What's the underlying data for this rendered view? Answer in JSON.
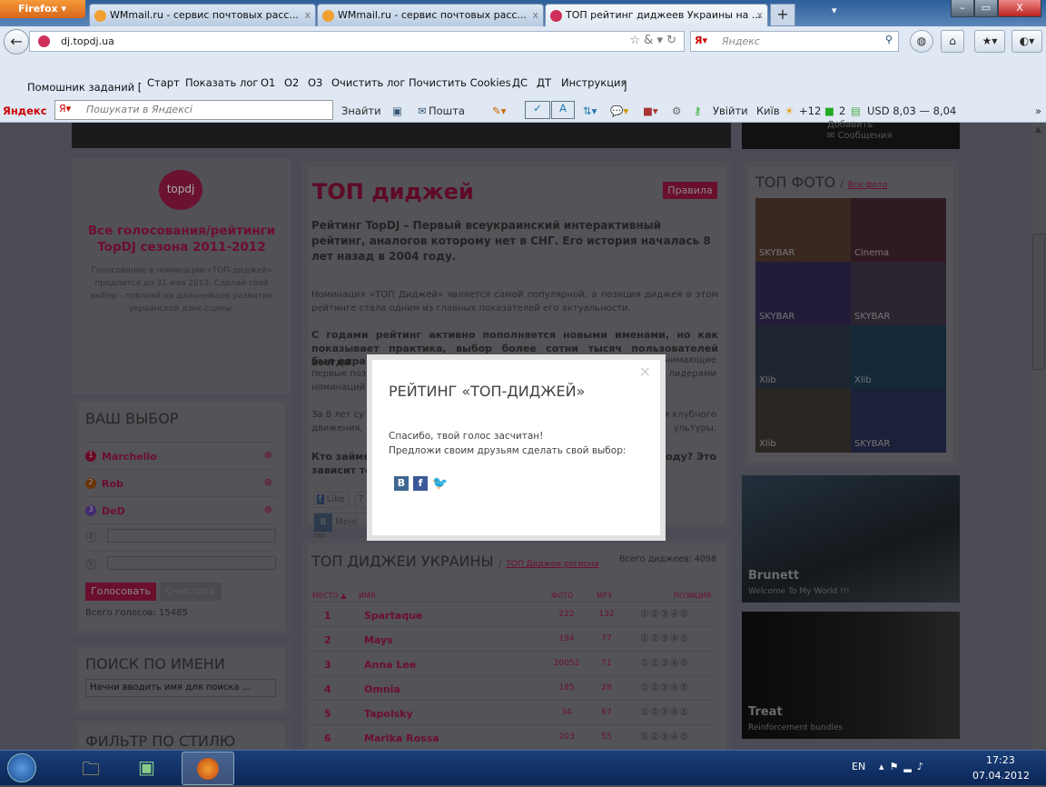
{
  "browser": {
    "menu_button": "Firefox",
    "tabs": [
      {
        "title": "WMmail.ru - сервис почтовых расс..."
      },
      {
        "title": "WMmail.ru - сервис почтовых расс..."
      },
      {
        "title": "ТОП рейтинг диджеев Украины на ..."
      }
    ],
    "url": "dj.topdj.ua",
    "search_placeholder": "Яндекс",
    "bookmarks": {
      "label": "Помошник заданий [",
      "items": [
        "Старт",
        "Показать лог",
        "О1",
        "О2",
        "О3",
        "Очистить лог",
        "Почистить Cookies",
        "ДС",
        "ДТ",
        "Инструкция"
      ],
      "close_bracket": "]"
    },
    "yandex_bar": {
      "logo": "Яндекс",
      "search_placeholder": "Пошукати в Яндексі",
      "find": "Знайти",
      "mail": "Пошта",
      "login": "Увійти",
      "city": "Київ",
      "temp": "+12",
      "count": "2",
      "usd": "USD 8,03 — 8,04"
    }
  },
  "header_right": {
    "add": "Добавить",
    "messages": "Сообщения"
  },
  "promo": {
    "logo": "topdj",
    "title": "Все голосования/рейтинги TopDJ сезона 2011-2012",
    "text": "Голосование в номинации «ТОП-диджей» продлится до 31 мая 2012. Сделай свой выбор - повлияй на дальнейшее развитие украинской дэнс-сцены."
  },
  "choice": {
    "title": "ВАШ ВЫБОР",
    "items": [
      {
        "n": "1",
        "name": "Marchello",
        "color": "#7a0a2a"
      },
      {
        "n": "2",
        "name": "Rob",
        "color": "#7a3a0a"
      },
      {
        "n": "3",
        "name": "DeD",
        "color": "#4a2a7a"
      }
    ],
    "empty": [
      "4",
      "5"
    ],
    "vote": "Голосовать",
    "clear": "Очистить",
    "total": "Всего голосов: 15485"
  },
  "search": {
    "title": "ПОИСК ПО ИМЕНИ",
    "placeholder": "Начни вводить имя для поиска ..."
  },
  "filter": {
    "title": "ФИЛЬТР ПО СТИЛЮ"
  },
  "intro": {
    "title": "ТОП диджей",
    "rules": "Правила",
    "lead": "Рейтинг TopDJ – Первый всеукраинский интерактивный рейтинг, аналогов которому нет в СНГ. Его история началась 8 лет назад в 2004 году.",
    "p1": "Номинация «ТОП Диджей» является самой популярной, а позиция диджея в этом рейтинге стала одним из главных показателей его актуальности.",
    "p2a": "С годами рейтинг активно пополняется новыми именами, но как показывает практика, выбор более сотни тысяч пользователей всегда",
    "p2b": "был опра",
    "p2c": "анимающие",
    "p2d": "первые поз",
    "p2e": "ь лидерами",
    "p2f": "номинаций",
    "p3a": "За 8 лет су",
    "p3b": "и клубного",
    "p3c": "движения,",
    "p3d": "ультуры.",
    "p4a": "Кто займе",
    "p4b": "году? Это",
    "p4c": "зависит то",
    "like": "Like",
    "like_count": "7",
    "vk_like": "Мені по"
  },
  "table": {
    "title": "ТОП ДИДЖЕИ УКРАИНЫ",
    "region_link": "ТОП Диджеи региона",
    "total": "Всего диджеев: 4098",
    "headers": {
      "place": "МЕСТО",
      "name": "ИМЯ",
      "photo": "ФОТО",
      "mp3": "MP3",
      "position": "ПОЗИЦИЯ"
    },
    "positions": "①②③④⑤",
    "rows": [
      {
        "place": "1",
        "name": "Spartaque",
        "photo": "222",
        "mp3": "132"
      },
      {
        "place": "2",
        "name": "Mays",
        "photo": "194",
        "mp3": "77"
      },
      {
        "place": "3",
        "name": "Anna Lee",
        "photo": "20052",
        "mp3": "71"
      },
      {
        "place": "4",
        "name": "Omnia",
        "photo": "185",
        "mp3": "28"
      },
      {
        "place": "5",
        "name": "Tapolsky",
        "photo": "34",
        "mp3": "67"
      },
      {
        "place": "6",
        "name": "Marika Rossa",
        "photo": "203",
        "mp3": "55"
      }
    ]
  },
  "top_photo": {
    "title": "ТОП ФОТО",
    "all_link": "Все фото",
    "tiles": [
      "SKYBAR",
      "Cinema",
      "SKYBAR",
      "SKYBAR",
      "Xlib",
      "Xlib",
      "Xlib",
      "SKYBAR"
    ]
  },
  "promo_cards": [
    {
      "title": "Brunett",
      "subtitle": "Welcome To My World !!!"
    },
    {
      "title": "Treat",
      "subtitle": "Reinforcement bundles"
    }
  ],
  "modal": {
    "title": "РЕЙТИНГ «ТОП-ДИДЖЕЙ»",
    "line1": "Спасибо, твой голос засчитан!",
    "line2": "Предложи своим друзьям сделать свой выбор:",
    "close": "×"
  },
  "taskbar": {
    "lang": "EN",
    "time": "17:23",
    "date": "07.04.2012"
  }
}
